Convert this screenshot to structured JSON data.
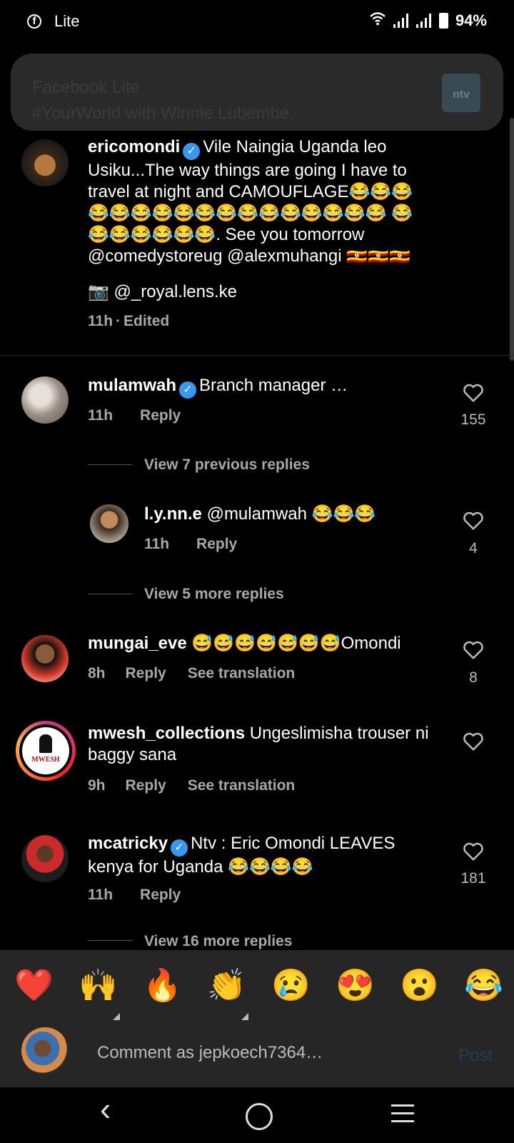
{
  "status_bar": {
    "app_name": "Lite",
    "battery": "94%"
  },
  "notification": {
    "title": "Facebook Lite",
    "subtitle": "#YourWorld with Winnie Lubembe.",
    "logo_text": "ntv"
  },
  "caption": {
    "username": "ericomondi",
    "text": "Vile Naingia Uganda leo Usiku...The way things are going I have to travel at night and CAMOUFLAGE😂😂😂 😂😂😂😂😂😂😂😂😂😂😂😂😂😂 😂😂😂😂😂😂😂. See you tomorrow @comedystoreug @alexmuhangi 🇺🇬🇺🇬🇺🇬",
    "credit": "📷 @_royal.lens.ke",
    "time": "11h",
    "edited": "Edited"
  },
  "comments": [
    {
      "username": "mulamwah",
      "text": "Branch manager …",
      "time": "11h",
      "reply": "Reply",
      "likes": "155"
    },
    {
      "username": "l.y.nn.e",
      "text": "@mulamwah 😂😂😂",
      "time": "11h",
      "reply": "Reply",
      "likes": "4"
    },
    {
      "username": "mungai_eve",
      "text": "😅😅😅😅😅😅😅Omondi",
      "time": "8h",
      "reply": "Reply",
      "translate": "See translation",
      "likes": "8"
    },
    {
      "username": "mwesh_collections",
      "text": "Ungeslimisha trouser ni baggy sana",
      "time": "9h",
      "reply": "Reply",
      "translate": "See translation",
      "likes": ""
    },
    {
      "username": "mcatricky",
      "text": "Ntv : Eric Omondi LEAVES kenya for Uganda 😂😂😂😂",
      "time": "11h",
      "reply": "Reply",
      "likes": "181"
    }
  ],
  "view_links": {
    "previous": "View 7 previous replies",
    "more_5": "View 5 more replies",
    "more_16": "View 16 more replies"
  },
  "avatar_texts": {
    "mwesh": "MWESH"
  },
  "reactions": [
    "❤️",
    "🙌",
    "🔥",
    "👏",
    "😢",
    "😍",
    "😮",
    "😂"
  ],
  "comment_input": {
    "placeholder": "Comment as jepkoech7364…",
    "post": "Post"
  },
  "nav": {
    "back": "‹",
    "home": "○",
    "recents": "≡"
  },
  "colors": {
    "verified": "#3897f0",
    "post_disabled": "#1e3e5a",
    "panel": "#262626"
  }
}
